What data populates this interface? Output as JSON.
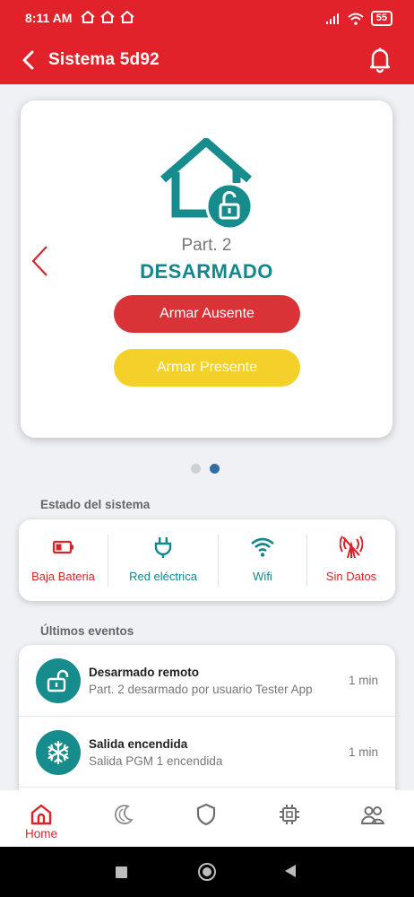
{
  "status_bar": {
    "time": "8:11 AM",
    "battery": "55"
  },
  "app_bar": {
    "title": "Sistema 5d92"
  },
  "partition": {
    "name": "Part. 2",
    "state": "DESARMADO",
    "arm_away_label": "Armar Ausente",
    "arm_stay_label": "Armar Presente",
    "state_icon": "house-unlocked-icon",
    "carousel_total": 2,
    "carousel_active": 2
  },
  "system_status": {
    "section_label": "Estado del sistema",
    "items": [
      {
        "label": "Baja Bateria",
        "icon": "battery-low-icon",
        "color": "#d9252a"
      },
      {
        "label": "Red eléctrica",
        "icon": "plug-icon",
        "color": "#12888d"
      },
      {
        "label": "Wifi",
        "icon": "wifi-icon",
        "color": "#12888d"
      },
      {
        "label": "Sin Datos",
        "icon": "no-signal-icon",
        "color": "#d9252a"
      }
    ]
  },
  "events": {
    "section_label": "Últimos eventos",
    "items": [
      {
        "title": "Desarmado remoto",
        "description": "Part. 2 desarmado por usuario Tester App",
        "time": "1 min",
        "icon": "unlocked-padlock-icon"
      },
      {
        "title": "Salida encendida",
        "description": "Salida PGM 1 encendida",
        "time": "1 min",
        "icon": "snowflake-icon"
      }
    ]
  },
  "bottom_nav": {
    "items": [
      {
        "label": "Home",
        "icon": "home-icon",
        "active": true
      },
      {
        "label": "",
        "icon": "moon-icon",
        "active": false
      },
      {
        "label": "",
        "icon": "shield-icon",
        "active": false
      },
      {
        "label": "",
        "icon": "chip-icon",
        "active": false
      },
      {
        "label": "",
        "icon": "users-icon",
        "active": false
      }
    ]
  },
  "colors": {
    "brand_red": "#e2222a",
    "teal": "#12888d",
    "yellow": "#f4d12a"
  }
}
